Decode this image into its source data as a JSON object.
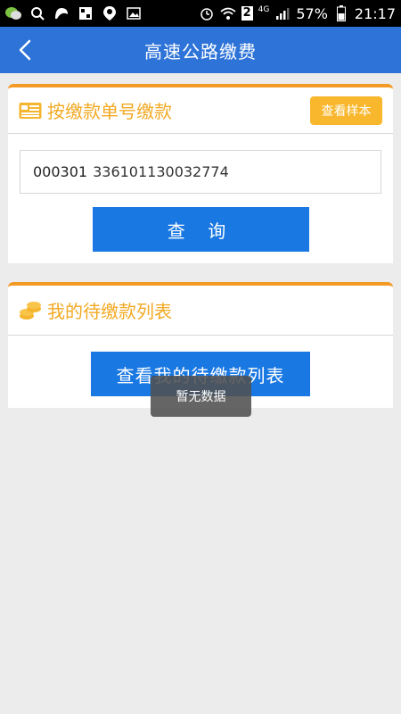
{
  "status_bar": {
    "icons": [
      "wechat-icon",
      "search-icon",
      "browser-icon",
      "gallery-icon",
      "map-pin-icon",
      "image-icon",
      "alarm-icon",
      "wifi-icon",
      "sim-icon",
      "signal-icon"
    ],
    "sim_label": "2",
    "network_label": "4G",
    "battery": "57%",
    "time": "21:17"
  },
  "header": {
    "title": "高速公路缴费"
  },
  "query_card": {
    "title": "按缴款单号缴款",
    "sample_button": "查看样本",
    "input_value_prefix": "000301",
    "input_value_number": "336101130032774",
    "query_button": "查 询"
  },
  "list_card": {
    "title": "我的待缴款列表",
    "list_button": "查看我的待缴款列表"
  },
  "toast": {
    "text": "暂无数据"
  },
  "colors": {
    "title_bar": "#2e73d8",
    "accent_orange": "#f39a25",
    "primary_button": "#1a78e2",
    "sample_button": "#f8b72c"
  }
}
